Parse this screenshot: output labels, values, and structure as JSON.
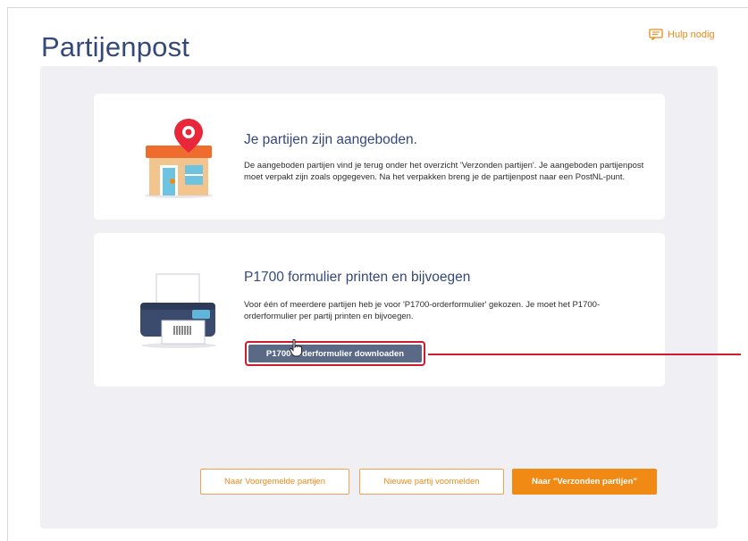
{
  "page": {
    "title": "Partijenpost"
  },
  "help": {
    "label": "Hulp nodig",
    "icon": "help-book-icon"
  },
  "cards": [
    {
      "illustration": "shop-location-icon",
      "title": "Je partijen zijn aangeboden.",
      "text": "De aangeboden partijen vind je terug onder het overzicht 'Verzonden partijen'. Je aangeboden partijenpost moet verpakt zijn zoals opgegeven. Na het verpakken breng je de partijenpost naar een PostNL-punt."
    },
    {
      "illustration": "printer-icon",
      "title": "P1700 formulier printen en bijvoegen",
      "text": "Voor één of meerdere partijen heb je voor 'P1700-orderformulier' gekozen. Je moet het P1700-orderformulier per partij printen en bijvoegen.",
      "button_label": "P1700-orderformulier downloaden"
    }
  ],
  "actions": {
    "previous": "Naar Voorgemelde partijen",
    "new": "Nieuwe partij voormelden",
    "sent": "Naar \"Verzonden partijen\""
  },
  "colors": {
    "title": "#34497a",
    "accent": "#f08a14",
    "highlight": "#d01a32",
    "button": "#5a6a86"
  }
}
